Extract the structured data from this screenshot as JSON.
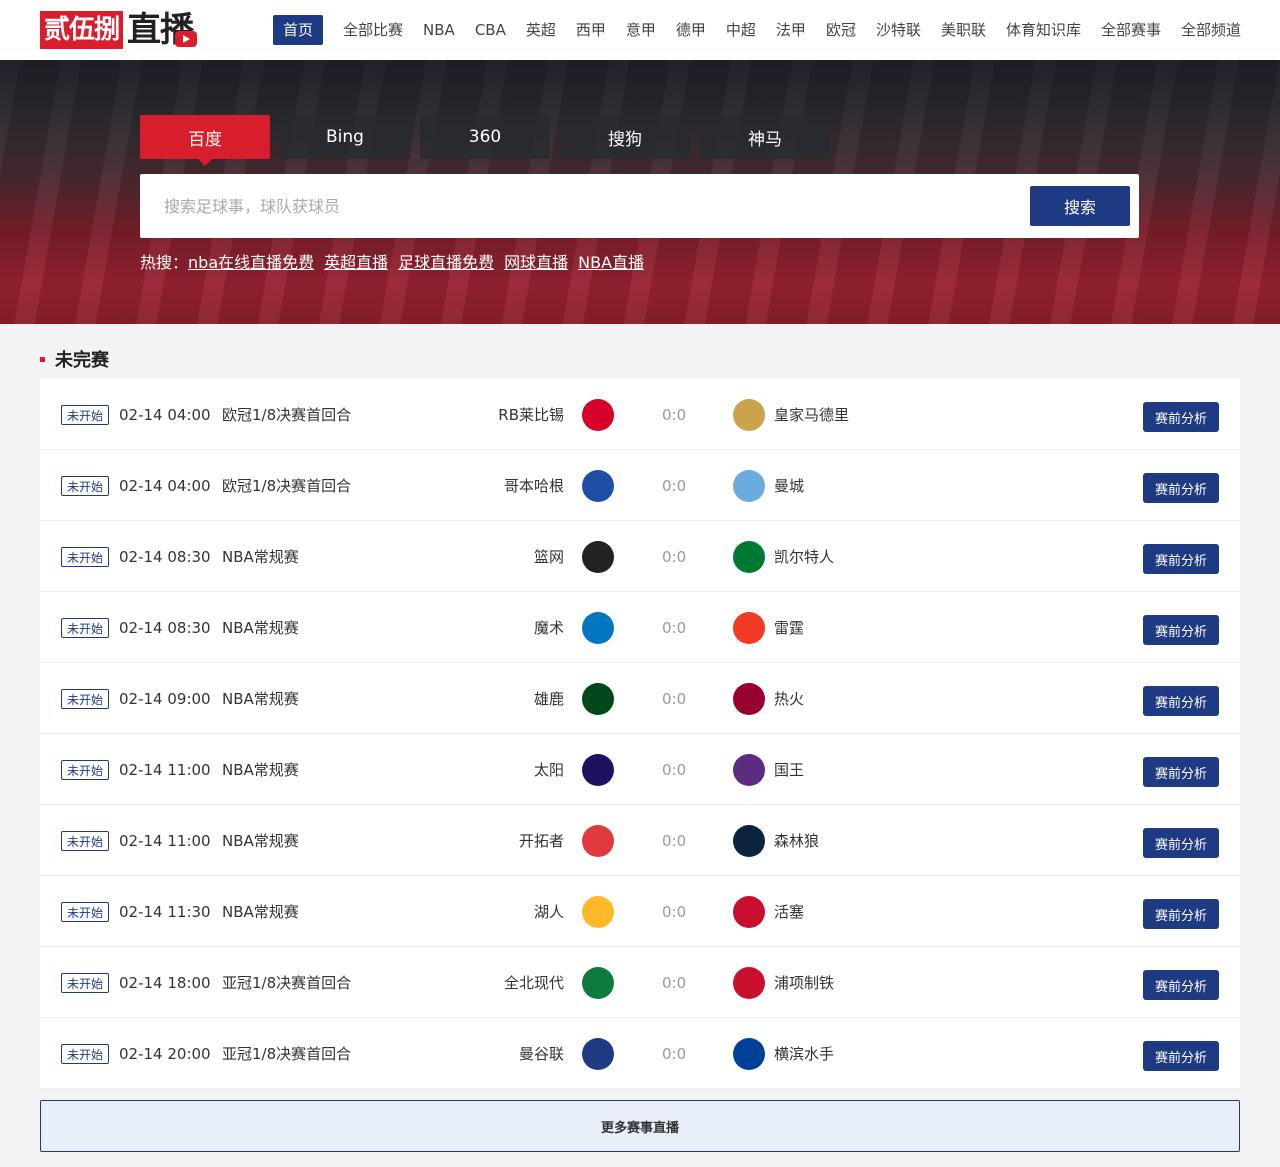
{
  "logo": {
    "part1": "贰伍捌",
    "part2": "直播"
  },
  "nav": [
    "首页",
    "全部比赛",
    "NBA",
    "CBA",
    "英超",
    "西甲",
    "意甲",
    "德甲",
    "中超",
    "法甲",
    "欧冠",
    "沙特联",
    "美职联",
    "体育知识库",
    "全部赛事",
    "全部频道"
  ],
  "search": {
    "engines": [
      "百度",
      "Bing",
      "360",
      "搜狗",
      "神马"
    ],
    "placeholder": "搜索足球事，球队获球员",
    "button": "搜索"
  },
  "hot": {
    "label": "热搜：",
    "links": [
      "nba在线直播免费",
      "英超直播",
      "足球直播免费",
      "网球直播",
      "NBA直播"
    ]
  },
  "section_title": "未完赛",
  "matches": [
    {
      "status": "未开始",
      "time": "02-14 04:00",
      "league": "欧冠1/8决赛首回合",
      "home": "RB莱比锡",
      "score": "0:0",
      "away": "皇家马德里",
      "action": "赛前分析",
      "home_color": "#d6002a",
      "away_color": "#c9a44c"
    },
    {
      "status": "未开始",
      "time": "02-14 04:00",
      "league": "欧冠1/8决赛首回合",
      "home": "哥本哈根",
      "score": "0:0",
      "away": "曼城",
      "action": "赛前分析",
      "home_color": "#1d4fa8",
      "away_color": "#6cabdd"
    },
    {
      "status": "未开始",
      "time": "02-14 08:30",
      "league": "NBA常规赛",
      "home": "篮网",
      "score": "0:0",
      "away": "凯尔特人",
      "action": "赛前分析",
      "home_color": "#222222",
      "away_color": "#007a33"
    },
    {
      "status": "未开始",
      "time": "02-14 08:30",
      "league": "NBA常规赛",
      "home": "魔术",
      "score": "0:0",
      "away": "雷霆",
      "action": "赛前分析",
      "home_color": "#0077c0",
      "away_color": "#ef3b24"
    },
    {
      "status": "未开始",
      "time": "02-14 09:00",
      "league": "NBA常规赛",
      "home": "雄鹿",
      "score": "0:0",
      "away": "热火",
      "action": "赛前分析",
      "home_color": "#00471b",
      "away_color": "#98002e"
    },
    {
      "status": "未开始",
      "time": "02-14 11:00",
      "league": "NBA常规赛",
      "home": "太阳",
      "score": "0:0",
      "away": "国王",
      "action": "赛前分析",
      "home_color": "#1d1160",
      "away_color": "#5a2d81"
    },
    {
      "status": "未开始",
      "time": "02-14 11:00",
      "league": "NBA常规赛",
      "home": "开拓者",
      "score": "0:0",
      "away": "森林狼",
      "action": "赛前分析",
      "home_color": "#e03a3e",
      "away_color": "#0c2340"
    },
    {
      "status": "未开始",
      "time": "02-14 11:30",
      "league": "NBA常规赛",
      "home": "湖人",
      "score": "0:0",
      "away": "活塞",
      "action": "赛前分析",
      "home_color": "#fdb927",
      "away_color": "#c8102e"
    },
    {
      "status": "未开始",
      "time": "02-14 18:00",
      "league": "亚冠1/8决赛首回合",
      "home": "全北现代",
      "score": "0:0",
      "away": "浦项制铁",
      "action": "赛前分析",
      "home_color": "#0e7a3e",
      "away_color": "#c8102e"
    },
    {
      "status": "未开始",
      "time": "02-14 20:00",
      "league": "亚冠1/8决赛首回合",
      "home": "曼谷联",
      "score": "0:0",
      "away": "横滨水手",
      "action": "赛前分析",
      "home_color": "#1e3a83",
      "away_color": "#004098"
    }
  ],
  "more_button": "更多赛事直播"
}
